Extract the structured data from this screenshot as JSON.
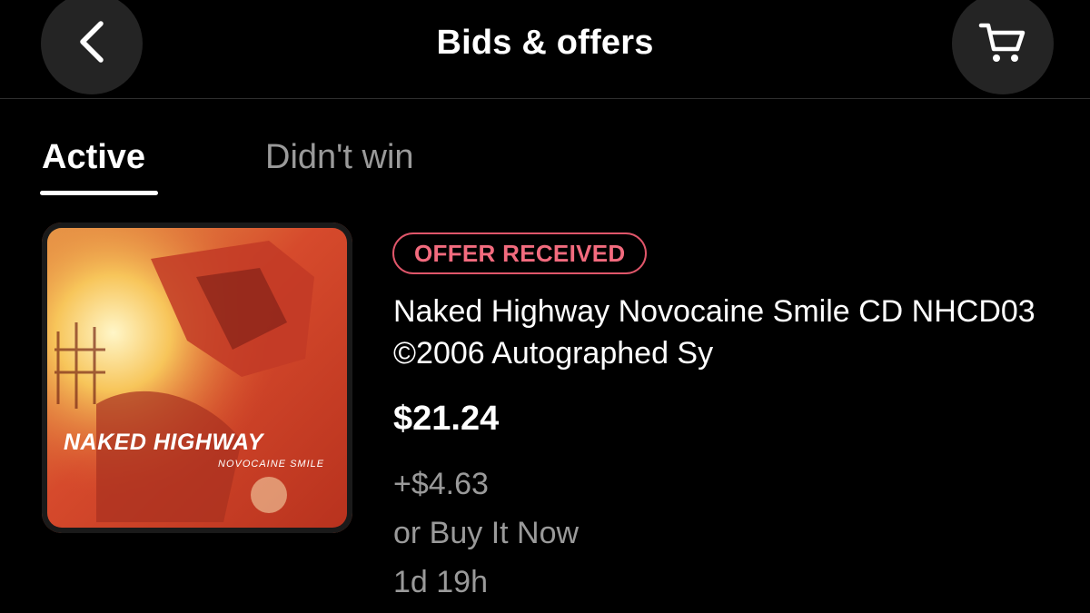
{
  "header": {
    "title": "Bids & offers",
    "back_icon": "chevron-left-icon",
    "cart_icon": "cart-icon"
  },
  "tabs": [
    {
      "label": "Active",
      "active": true
    },
    {
      "label": "Didn't win",
      "active": false
    }
  ],
  "listing": {
    "badge": "OFFER RECEIVED",
    "title": "Naked Highway Novocaine Smile CD NHCD03 ©2006 Autographed Sy",
    "price": "$21.24",
    "shipping": "+$4.63",
    "buy_it_now": "or Buy It Now",
    "time_left": "1d 19h",
    "thumbnail": {
      "artist_text": "NAKED HIGHWAY",
      "album_text": "NOVOCAINE SMILE"
    }
  },
  "colors": {
    "background": "#000000",
    "badge_accent": "#e0566a",
    "secondary_text": "#9a9a9a",
    "button_bg": "#242424"
  }
}
